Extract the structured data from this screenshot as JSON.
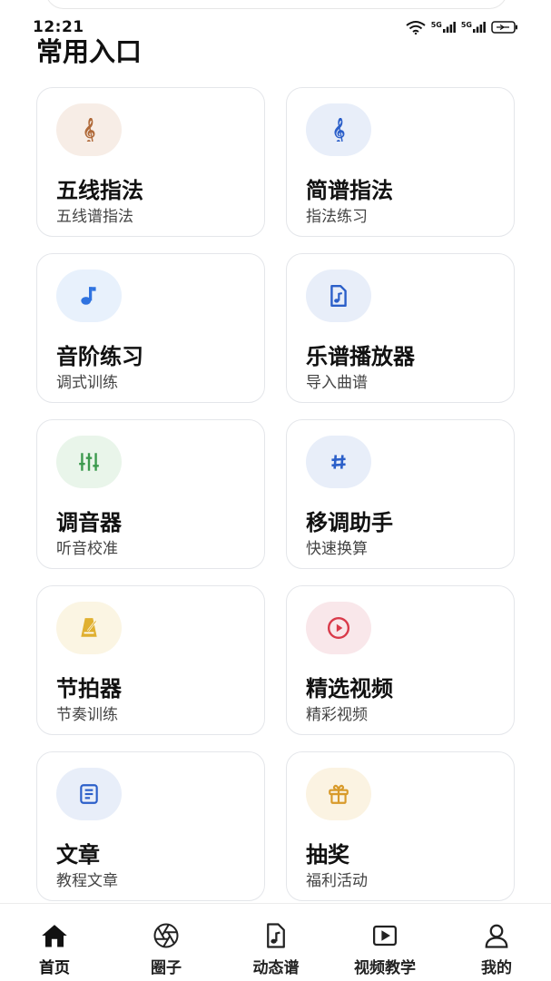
{
  "status": {
    "time": "12:21",
    "signal1": "5G",
    "signal2": "5G"
  },
  "section_title": "常用入口",
  "cards": [
    {
      "title": "五线指法",
      "subtitle": "五线谱指法",
      "icon": "treble-clef-icon",
      "icon_color": "#b06a3a",
      "bg": "#f7ede6"
    },
    {
      "title": "简谱指法",
      "subtitle": "指法练习",
      "icon": "treble-clef-icon",
      "icon_color": "#2b5fc9",
      "bg": "#e8eef9"
    },
    {
      "title": "音阶练习",
      "subtitle": "调式训练",
      "icon": "music-note-icon",
      "icon_color": "#2f73e0",
      "bg": "#e8f1fc"
    },
    {
      "title": "乐谱播放器",
      "subtitle": "导入曲谱",
      "icon": "music-file-icon",
      "icon_color": "#2b5fc9",
      "bg": "#e8eef9"
    },
    {
      "title": "调音器",
      "subtitle": "听音校准",
      "icon": "sliders-icon",
      "icon_color": "#3c9a4e",
      "bg": "#e9f5ea"
    },
    {
      "title": "移调助手",
      "subtitle": "快速换算",
      "icon": "sharp-icon",
      "icon_color": "#2b5fc9",
      "bg": "#e8eef9"
    },
    {
      "title": "节拍器",
      "subtitle": "节奏训练",
      "icon": "metronome-icon",
      "icon_color": "#e0b030",
      "bg": "#fbf5e3"
    },
    {
      "title": "精选视频",
      "subtitle": "精彩视频",
      "icon": "play-circle-icon",
      "icon_color": "#d93a4a",
      "bg": "#f9e7ea"
    },
    {
      "title": "文章",
      "subtitle": "教程文章",
      "icon": "document-icon",
      "icon_color": "#2b5fc9",
      "bg": "#e8eef9"
    },
    {
      "title": "抽奖",
      "subtitle": "福利活动",
      "icon": "gift-icon",
      "icon_color": "#d89a2a",
      "bg": "#fbf3e2"
    }
  ],
  "nav": [
    {
      "label": "首页",
      "icon": "home-icon",
      "active": true
    },
    {
      "label": "圈子",
      "icon": "aperture-icon",
      "active": false
    },
    {
      "label": "动态谱",
      "icon": "music-file-icon",
      "active": false
    },
    {
      "label": "视频教学",
      "icon": "video-icon",
      "active": false
    },
    {
      "label": "我的",
      "icon": "user-icon",
      "active": false
    }
  ]
}
